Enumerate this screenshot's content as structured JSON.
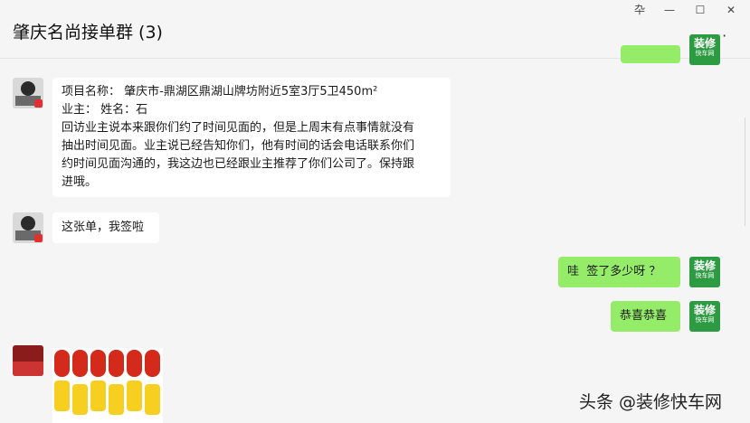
{
  "window": {
    "title": "肇庆名尚接单群 (3)",
    "pin_glyph": "卆",
    "minimize_glyph": "—",
    "maximize_glyph": "☐",
    "close_glyph": "✕",
    "more_glyph": "···"
  },
  "messages": [
    {
      "sender": "other",
      "avatar": "person-avatar",
      "lines": [
        "项目名称： 肇庆市-鼎湖区鼎湖山牌坊附近5室3厅5卫450m²",
        "业主： 姓名：石",
        "回访业主说本来跟你们约了时间见面的，但是上周末有点事情就没有",
        "抽出时间见面。业主说已经告知你们，他有时间的话会电话联系你们",
        "约时间见面沟通的，我这边也已经跟业主推荐了你们公司了。保持跟",
        "进哦。"
      ]
    },
    {
      "sender": "other",
      "avatar": "person-avatar",
      "text": "这张单，我签啦"
    },
    {
      "sender": "self",
      "avatar": "logo-avatar",
      "text": "哇  签了多少呀 ？"
    },
    {
      "sender": "self",
      "avatar": "logo-avatar",
      "text": "恭喜恭喜"
    },
    {
      "sender": "other",
      "avatar": "group-avatar",
      "image": "firecracker-image"
    }
  ],
  "logo": {
    "line1": "装修",
    "line2": "快车网"
  },
  "watermark": "头条 @装修快车网",
  "colors": {
    "self_bubble": "#95ec69",
    "other_bubble": "#ffffff",
    "background": "#f5f5f5"
  }
}
